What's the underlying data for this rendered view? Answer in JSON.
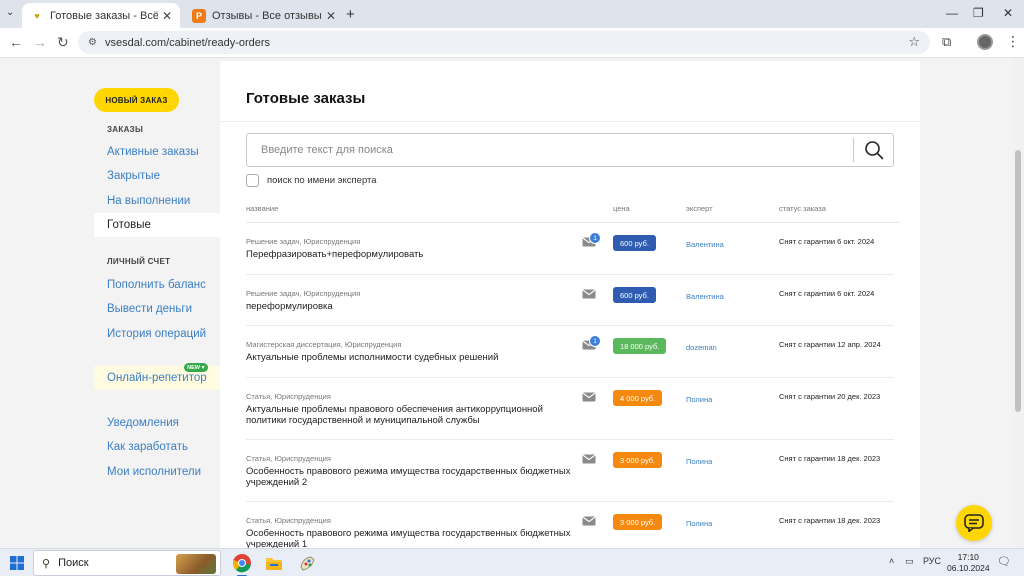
{
  "browser": {
    "tabs": [
      {
        "title": "Готовые заказы - Всё сдал!",
        "icon": "vsesdal-favicon"
      },
      {
        "title": "Отзывы - Все отзывы",
        "icon": "p-favicon"
      }
    ],
    "url": "vsesdal.com/cabinet/ready-orders"
  },
  "sidebar": {
    "new_order": "НОВЫЙ ЗАКАЗ",
    "orders_section": "ЗАКАЗЫ",
    "orders_links": [
      "Активные заказы",
      "Закрытые",
      "На выполнении",
      "Готовые"
    ],
    "account_section": "ЛИЧНЫЙ СЧЕТ",
    "account_links": [
      "Пополнить баланс",
      "Вывести деньги",
      "История операций"
    ],
    "tutor": "Онлайн-репетитор",
    "tutor_badge": "NEW",
    "other_links": [
      "Уведомления",
      "Как заработать",
      "Мои исполнители"
    ]
  },
  "main": {
    "title": "Готовые заказы",
    "search_placeholder": "Введите текст для поиска",
    "search_by_expert": "поиск по имени эксперта",
    "columns": [
      "название",
      "цена",
      "эксперт",
      "статус заказа"
    ],
    "orders": [
      {
        "category": "Решение задач, Юриспруденция",
        "name": "Перефразировать+переформулировать",
        "messages": "1",
        "price": "600 руб.",
        "price_color": "#2f5bb0",
        "expert": "Валентина",
        "status": "Снят с гарантии 6 окт. 2024"
      },
      {
        "category": "Решение задач, Юриспруденция",
        "name": "переформулировка",
        "messages": "",
        "price": "600 руб.",
        "price_color": "#2f5bb0",
        "expert": "Валентина",
        "status": "Снят с гарантии 6 окт. 2024"
      },
      {
        "category": "Магистерская диссертация, Юриспруденция",
        "name": "Актуальные проблемы исполнимости судебных решений",
        "messages": "1",
        "price": "18 000 руб.",
        "price_color": "#5cb85c",
        "expert": "dozeman",
        "status": "Снят с гарантии 12 апр. 2024"
      },
      {
        "category": "Статья, Юриспруденция",
        "name": "Актуальные проблемы правового обеспечения антикоррупционной политики государственной и муниципальной службы",
        "messages": "",
        "price": "4 000 руб.",
        "price_color": "#f5890f",
        "expert": "Полина",
        "status": "Снят с гарантии 20 дек. 2023"
      },
      {
        "category": "Статья, Юриспруденция",
        "name": "Особенность правового режима имущества государственных бюджетных учреждений 2",
        "messages": "",
        "price": "3 000 руб.",
        "price_color": "#f5890f",
        "expert": "Полина",
        "status": "Снят с гарантии 18 дек. 2023"
      },
      {
        "category": "Статья, Юриспруденция",
        "name": "Особенность правового режима имущества государственных бюджетных учреждений 1",
        "messages": "",
        "price": "3 000 руб.",
        "price_color": "#f5890f",
        "expert": "Полина",
        "status": "Снят с гарантии 18 дек. 2023"
      }
    ]
  },
  "taskbar": {
    "search": "Поиск",
    "lang": "РУС",
    "time": "17:10",
    "date": "06.10.2024"
  }
}
